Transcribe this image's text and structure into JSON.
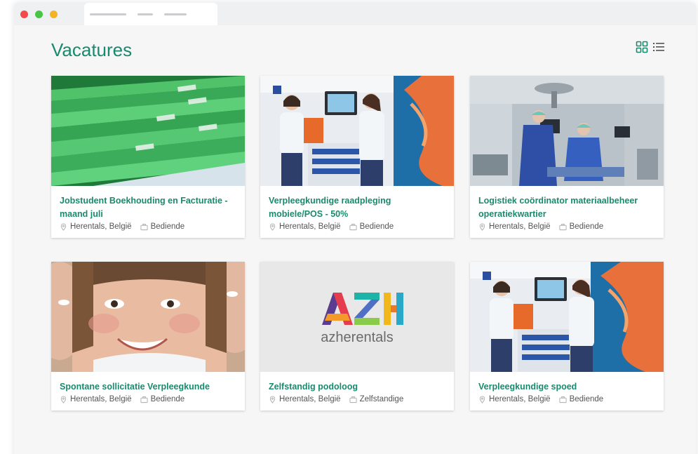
{
  "browser": {
    "dots": [
      "#f44a4a",
      "#48c548",
      "#f5b324"
    ]
  },
  "page": {
    "title": "Vacatures"
  },
  "view_toggle": {
    "grid_icon": "grid-icon",
    "list_icon": "list-icon"
  },
  "colors": {
    "accent": "#1a8a6d"
  },
  "jobs": [
    {
      "title": "Jobstudent Boekhouding en Facturatie - maand juli",
      "location": "Herentals, België",
      "type": "Bediende",
      "image": "green-file-folders"
    },
    {
      "title": "Verpleegkundige raadpleging mobiele/POS - 50%",
      "location": "Herentals, België",
      "type": "Bediende",
      "image": "two-nurses-with-cart"
    },
    {
      "title": "Logistiek coördinator materiaalbeheer operatiekwartier",
      "location": "Herentals, België",
      "type": "Bediende",
      "image": "operating-room"
    },
    {
      "title": "Spontane sollicitatie Verpleegkunde",
      "location": "Herentals, België",
      "type": "Bediende",
      "image": "smiling-face-closeup"
    },
    {
      "title": "Zelfstandig podoloog",
      "location": "Herentals, België",
      "type": "Zelfstandige",
      "image": "azherentals-logo",
      "logo_text": "azherentals",
      "logo_mark": "AZH"
    },
    {
      "title": "Verpleegkundige spoed",
      "location": "Herentals, België",
      "type": "Bediende",
      "image": "two-nurses-with-cart"
    }
  ]
}
